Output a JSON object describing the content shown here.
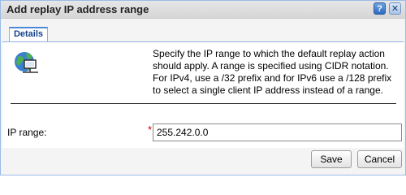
{
  "dialog": {
    "title": "Add replay IP address range",
    "help_icon": "question-icon",
    "close_icon": "close-icon"
  },
  "tabs": [
    {
      "label": "Details",
      "active": true
    }
  ],
  "details": {
    "icon": "globe-network-icon",
    "description": "Specify the IP range to which the default replay action should apply. A range is specified using CIDR notation. For IPv4, use a /32 prefix and for IPv6 use a /128 prefix to select a single client IP address instead of a range."
  },
  "form": {
    "ip_range_label": "IP range:",
    "required_marker": "*",
    "ip_range_value": "255.242.0.0"
  },
  "buttons": {
    "save": "Save",
    "cancel": "Cancel"
  },
  "colors": {
    "accent": "#4d8ad6",
    "required": "#cc0000"
  }
}
